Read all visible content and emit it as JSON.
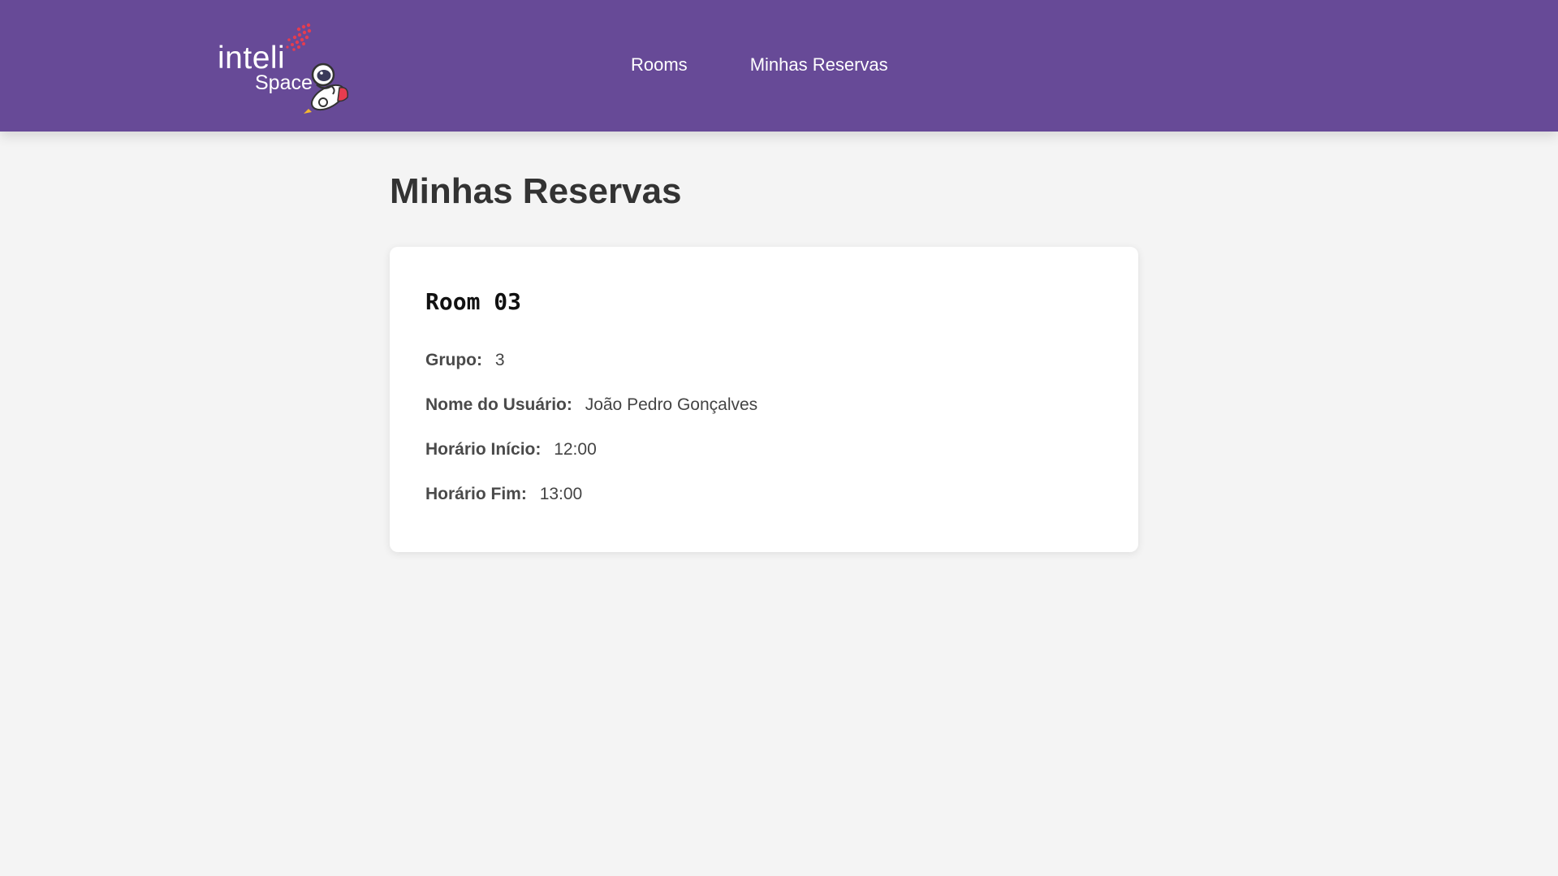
{
  "logo": {
    "primary": "inteli",
    "secondary": "Space"
  },
  "nav": {
    "items": [
      {
        "label": "Rooms"
      },
      {
        "label": "Minhas Reservas"
      }
    ]
  },
  "page": {
    "title": "Minhas Reservas"
  },
  "reservation": {
    "room_name": "Room 03",
    "fields": [
      {
        "label": "Grupo:",
        "value": "3"
      },
      {
        "label": "Nome do Usuário:",
        "value": "João Pedro Gonçalves"
      },
      {
        "label": "Horário Início:",
        "value": "12:00"
      },
      {
        "label": "Horário Fim:",
        "value": "13:00"
      }
    ]
  },
  "colors": {
    "navbar": "#674a97",
    "background": "#f4f4f4",
    "card": "#ffffff",
    "accent_red": "#e63c4f"
  },
  "icons": [
    "dot-grid-logo-icon",
    "astronaut-rocket-icon"
  ]
}
